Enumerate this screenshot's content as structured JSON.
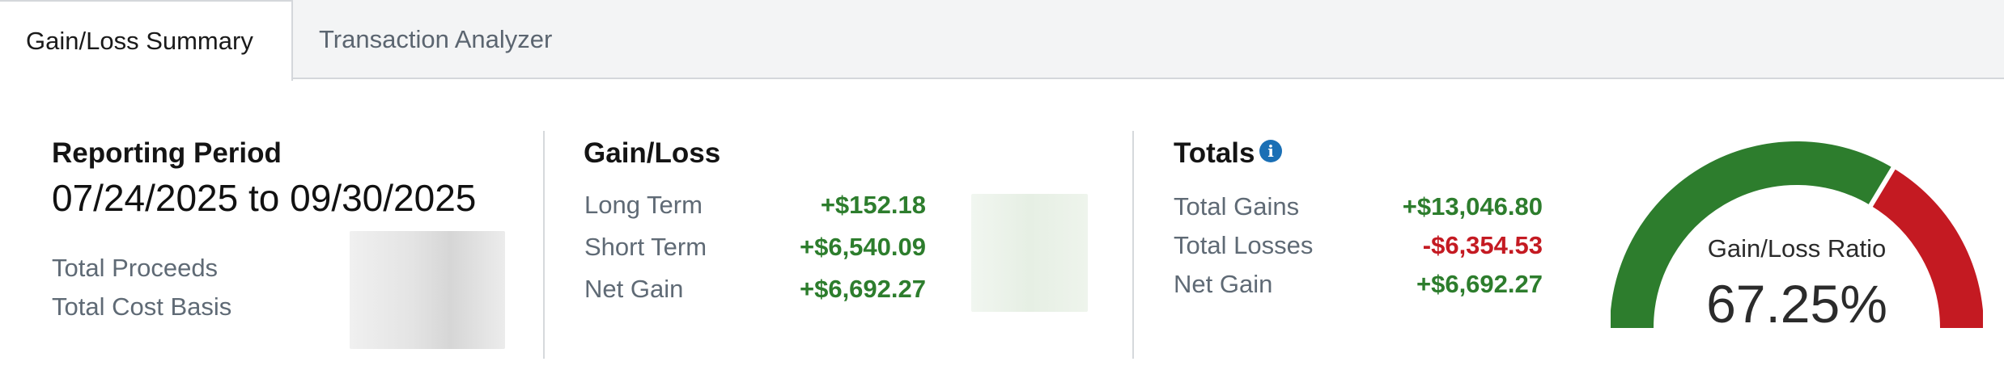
{
  "tabs": [
    {
      "label": "Gain/Loss Summary",
      "active": true
    },
    {
      "label": "Transaction Analyzer",
      "active": false
    }
  ],
  "reporting": {
    "heading": "Reporting Period",
    "range": "07/24/2025 to 09/30/2025",
    "rows": [
      {
        "label": "Total Proceeds"
      },
      {
        "label": "Total Cost Basis"
      }
    ]
  },
  "gainloss": {
    "heading": "Gain/Loss",
    "rows": [
      {
        "label": "Long Term",
        "value": "+$152.18"
      },
      {
        "label": "Short Term",
        "value": "+$6,540.09"
      },
      {
        "label": "Net Gain",
        "value": "+$6,692.27"
      }
    ]
  },
  "totals": {
    "heading": "Totals",
    "info_icon": "info-icon",
    "rows": [
      {
        "label": "Total Gains",
        "value": "+$13,046.80"
      },
      {
        "label": "Total Losses",
        "value": "-$6,354.53"
      },
      {
        "label": "Net Gain",
        "value": "+$6,692.27"
      }
    ]
  },
  "gauge": {
    "title": "Gain/Loss Ratio",
    "value_text": "67.25%",
    "ratio": 0.6725,
    "gain_color": "#2d7d2d",
    "loss_color": "#c41a22"
  },
  "colors": {
    "positive": "#2d7d2d",
    "negative": "#c41a22",
    "info": "#1a6fb5"
  }
}
